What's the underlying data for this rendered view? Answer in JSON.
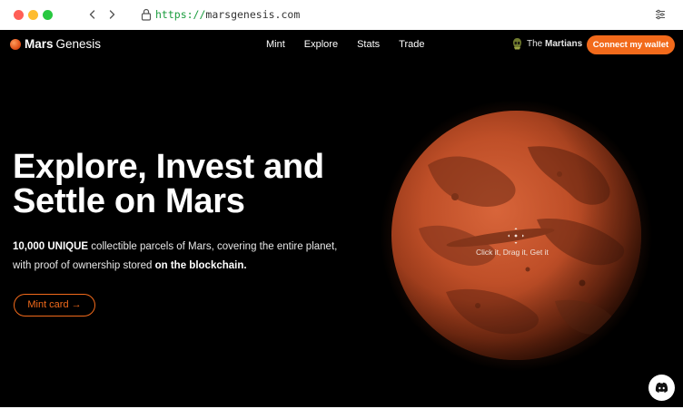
{
  "browser": {
    "url_scheme": "https://",
    "url_host": "marsgenesis.com"
  },
  "site_nav": {
    "brand_strong": "Mars",
    "brand_light": "Genesis",
    "links": [
      "Mint",
      "Explore",
      "Stats",
      "Trade"
    ],
    "martians_light": "The",
    "martians_bold": "Martians",
    "connect_label": "Connect my wallet"
  },
  "hero": {
    "title_line1": "Explore, Invest and",
    "title_line2": "Settle on Mars",
    "desc_bold": "10,000 UNIQUE",
    "desc_part1": " collectible parcels of Mars, covering the entire planet,",
    "desc_part2": "with proof of ownership stored ",
    "desc_bold2": "on the blockchain.",
    "mint_label": "Mint card →"
  },
  "mars": {
    "hint": "Click it, Drag it, Get it"
  },
  "colors": {
    "accent": "#f26a1b",
    "background": "#000000"
  },
  "icons": {
    "discord": "discord-icon",
    "lock": "lock-icon",
    "menu": "menu-icon"
  }
}
